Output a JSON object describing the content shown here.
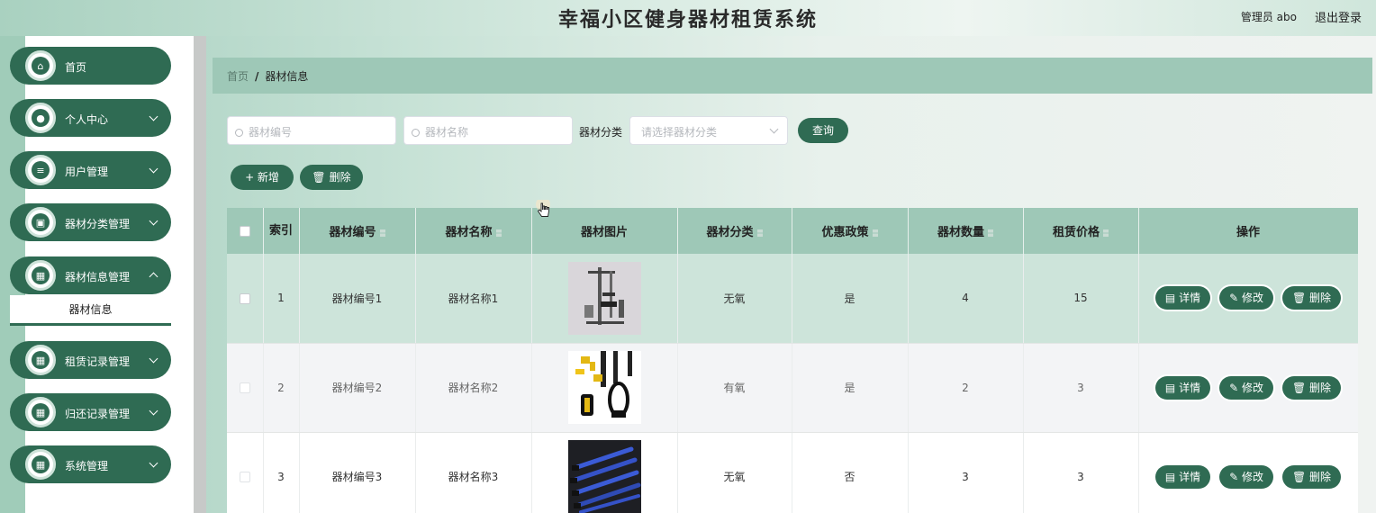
{
  "header": {
    "title": "幸福小区健身器材租赁系统",
    "user": "管理员 abo",
    "logout": "退出登录"
  },
  "sidebar": {
    "items": [
      {
        "label": "首页",
        "icon": "home-icon",
        "glyph": "⌂"
      },
      {
        "label": "个人中心",
        "icon": "person-icon",
        "glyph": "●"
      },
      {
        "label": "用户管理",
        "icon": "list-icon",
        "glyph": "≡"
      },
      {
        "label": "器材分类管理",
        "icon": "clipboard-icon",
        "glyph": "▣"
      },
      {
        "label": "器材信息管理",
        "icon": "grid-icon",
        "glyph": "▦"
      },
      {
        "label": "租赁记录管理",
        "icon": "grid-icon",
        "glyph": "▦"
      },
      {
        "label": "归还记录管理",
        "icon": "grid-icon",
        "glyph": "▦"
      },
      {
        "label": "系统管理",
        "icon": "grid-icon",
        "glyph": "▦"
      }
    ],
    "sub_item": "器材信息"
  },
  "breadcrumb": {
    "home": "首页",
    "sep": "/",
    "current": "器材信息"
  },
  "search": {
    "code_placeholder": "器材编号",
    "name_placeholder": "器材名称",
    "category_label": "器材分类",
    "category_placeholder": "请选择器材分类",
    "query_label": "查询"
  },
  "toolbar": {
    "add_label": "+ 新增",
    "delete_label": "删除"
  },
  "table": {
    "columns": [
      "索引",
      "器材编号",
      "器材名称",
      "器材图片",
      "器材分类",
      "优惠政策",
      "器材数量",
      "租赁价格",
      "操作"
    ],
    "rows": [
      {
        "index": "1",
        "code": "器材编号1",
        "name": "器材名称1",
        "category": "无氧",
        "discount": "是",
        "quantity": "4",
        "price": "15"
      },
      {
        "index": "2",
        "code": "器材编号2",
        "name": "器材名称2",
        "category": "有氧",
        "discount": "是",
        "quantity": "2",
        "price": "3"
      },
      {
        "index": "3",
        "code": "器材编号3",
        "name": "器材名称3",
        "category": "无氧",
        "discount": "否",
        "quantity": "3",
        "price": "3"
      }
    ],
    "actions": {
      "detail": "详情",
      "edit": "修改",
      "delete": "删除"
    }
  },
  "colors": {
    "primary": "#2f6b53",
    "header_bg": "#9ec8b7",
    "row_highlight": "#cde4da"
  }
}
